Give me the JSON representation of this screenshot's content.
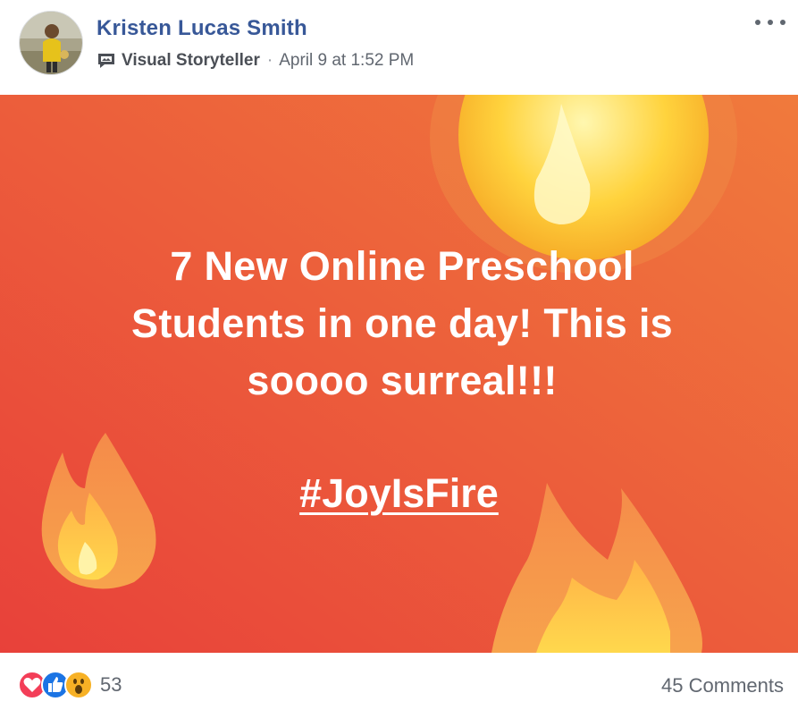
{
  "post": {
    "author": "Kristen Lucas Smith",
    "badge_icon": "visual-storyteller-badge-icon",
    "badge_label": "Visual Storyteller",
    "separator": "·",
    "timestamp": "April 9 at 1:52 PM",
    "more_icon": "more-options-icon"
  },
  "content": {
    "lines": [
      "7 New Online Preschool",
      "Students in one day! This is",
      "soooo surreal!!!"
    ],
    "hashtag": "#JoyIsFire",
    "background_colors": [
      "#e8413a",
      "#f07a3c"
    ]
  },
  "footer": {
    "reactions": [
      "love-reaction-icon",
      "like-reaction-icon",
      "wow-reaction-icon"
    ],
    "reaction_count": "53",
    "comments": "45 Comments"
  }
}
